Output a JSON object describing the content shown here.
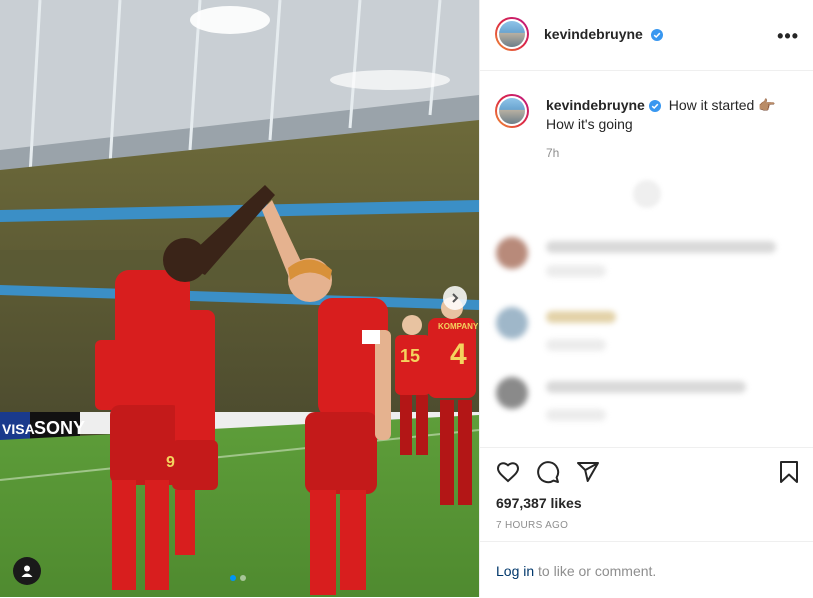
{
  "post": {
    "username": "kevindebruyne",
    "caption_line1": "How it started",
    "caption_emoji": "👉🏽",
    "caption_line2": "How it's going",
    "time_ago": "7h",
    "likes": "697,387 likes",
    "posted_ago": "7 HOURS AGO"
  },
  "login_prompt": {
    "link": "Log in",
    "rest": " to like or comment."
  },
  "media": {
    "stadium_banners": [
      "VISA",
      "SONY"
    ],
    "jersey_numbers": [
      "9",
      "15",
      "4"
    ],
    "jersey_name": "KOMPANY",
    "carousel_total": 2,
    "carousel_active": 1
  },
  "colors": {
    "verified": "#3897f0",
    "link": "#00376b",
    "carousel_active": "#0095f6",
    "jersey_red": "#d81e1e"
  },
  "icons": [
    "more-options-icon",
    "verified-badge-icon",
    "heart-icon",
    "comment-icon",
    "share-icon",
    "bookmark-icon",
    "chevron-right-icon",
    "user-tag-icon"
  ]
}
